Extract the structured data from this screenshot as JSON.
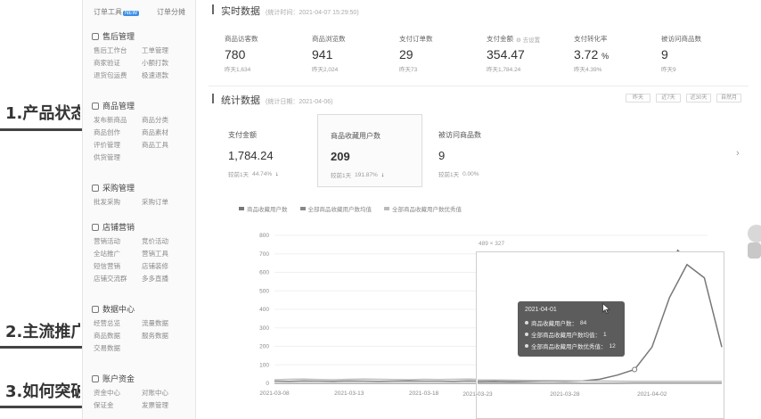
{
  "slide": {
    "headings": [
      "1.产品状态",
      "2.主流推广",
      "3.如何突破"
    ]
  },
  "sidebar": {
    "top": [
      {
        "label": "订单工具",
        "badge": "NEW"
      },
      {
        "label": "订单分摊"
      }
    ],
    "sections": [
      {
        "title": "售后管理",
        "items": [
          "售后工作台",
          "工单管理",
          "商家验证",
          "小额打款",
          "退货包运费",
          "极速退款"
        ]
      },
      {
        "title": "商品管理",
        "items": [
          "发布新商品",
          "商品分类",
          "商品创作",
          "商品素材",
          "评价管理",
          "商品工具",
          "供货管理"
        ]
      },
      {
        "title": "采购管理",
        "items": [
          "批发采购",
          "采购订单"
        ]
      },
      {
        "title": "店铺营销",
        "items": [
          "营销活动",
          "竞价活动",
          "全站推广",
          "营销工具",
          "短信营销",
          "店铺装修",
          "店铺交流群",
          "多多直播"
        ]
      },
      {
        "title": "数据中心",
        "items": [
          "经营总览",
          "流量数据",
          "商品数据",
          "服务数据",
          "交易数据"
        ]
      },
      {
        "title": "账户资金",
        "items": [
          "资金中心",
          "对账中心",
          "保证金",
          "发票管理"
        ]
      }
    ]
  },
  "realtime": {
    "title": "实时数据",
    "meta": "(统计时间：2021-04-07 15:29:50)",
    "metrics": [
      {
        "label": "商品访客数",
        "value": "780",
        "sub": "昨天1,634"
      },
      {
        "label": "商品浏览数",
        "value": "941",
        "sub": "昨天2,024"
      },
      {
        "label": "支付订单数",
        "value": "29",
        "sub": "昨天73"
      },
      {
        "label": "支付金额",
        "help": "去设置",
        "value": "354.47",
        "sub": "昨天1,784.24"
      },
      {
        "label": "支付转化率",
        "value": "3.72",
        "unit": "%",
        "sub": "昨天4.39%"
      },
      {
        "label": "被访问商品数",
        "value": "9",
        "sub": "昨天9"
      }
    ]
  },
  "stats": {
    "title": "统计数据",
    "meta": "(统计日期：2021-04-06)",
    "buttons": [
      "昨天",
      "近7天",
      "近30天",
      "自然月"
    ],
    "cards": [
      {
        "label": "支付金额",
        "value": "1,784.24",
        "compare_label": "较前1天",
        "compare_value": "44.74%"
      },
      {
        "label": "商品收藏用户数",
        "value": "209",
        "compare_label": "较前1天",
        "compare_value": "191.87%"
      },
      {
        "label": "被访问商品数",
        "value": "9",
        "compare_label": "较前1天",
        "compare_value": "0.00%"
      }
    ]
  },
  "chart_data": {
    "type": "line",
    "legend": [
      "商品收藏用户数",
      "全部商品收藏用户数均值",
      "全部商品收藏用户数优秀值"
    ],
    "x": [
      "2021-03-08",
      "2021-03-09",
      "2021-03-10",
      "2021-03-11",
      "2021-03-12",
      "2021-03-13",
      "2021-03-14",
      "2021-03-15",
      "2021-03-16",
      "2021-03-17",
      "2021-03-18",
      "2021-03-19",
      "2021-03-20",
      "2021-03-21",
      "2021-03-22",
      "2021-03-23",
      "2021-03-24",
      "2021-03-25",
      "2021-03-26",
      "2021-03-27",
      "2021-03-28",
      "2021-03-29",
      "2021-03-30",
      "2021-03-31",
      "2021-04-01",
      "2021-04-02",
      "2021-04-03",
      "2021-04-04",
      "2021-04-05",
      "2021-04-06"
    ],
    "x_tick_labels": [
      "2021-03-08",
      "2021-03-13",
      "2021-03-18",
      "2021-03-23",
      "2021-03-28",
      "2021-04-02"
    ],
    "y_ticks": [
      0,
      100,
      200,
      300,
      400,
      500,
      600,
      700,
      800
    ],
    "ylim": [
      0,
      800
    ],
    "series": [
      {
        "name": "商品收藏用户数",
        "values": [
          12,
          11,
          13,
          12,
          11,
          13,
          12,
          11,
          12,
          13,
          12,
          12,
          11,
          13,
          12,
          11,
          12,
          10,
          12,
          14,
          12,
          15,
          25,
          50,
          84,
          220,
          520,
          720,
          640,
          220
        ]
      },
      {
        "name": "全部商品收藏用户数均值",
        "values": [
          0,
          0,
          0,
          0,
          0,
          0,
          0,
          0,
          0,
          0,
          0,
          0,
          0,
          0,
          0,
          0,
          0,
          0,
          0,
          0,
          0,
          0,
          0,
          0,
          1,
          1,
          1,
          1,
          1,
          1
        ]
      },
      {
        "name": "全部商品收藏用户数优秀值",
        "values": [
          20,
          22,
          23,
          21,
          20,
          22,
          23,
          22,
          21,
          20,
          22,
          21,
          22,
          23,
          21,
          20,
          20,
          19,
          18,
          17,
          16,
          15,
          14,
          13,
          12,
          12,
          12,
          12,
          12,
          12
        ]
      }
    ]
  },
  "tooltip": {
    "date": "2021-04-01",
    "rows": [
      {
        "label": "商品收藏用户数：",
        "value": "84"
      },
      {
        "label": "全部商品收藏用户数均值：",
        "value": "1"
      },
      {
        "label": "全部商品收藏用户数优秀值：",
        "value": "12"
      }
    ]
  },
  "overlay": {
    "size_label": "489 × 327"
  }
}
